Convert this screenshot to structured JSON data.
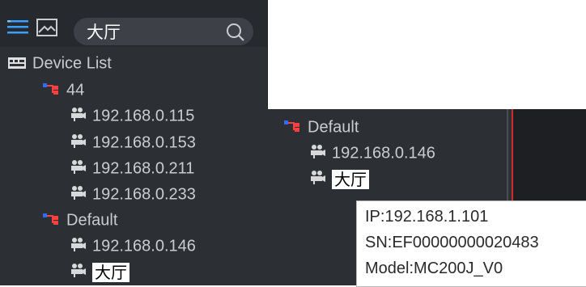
{
  "search": {
    "value": "大厅"
  },
  "tree": {
    "root_label": "Device List",
    "groups": [
      {
        "label": "44",
        "devices": [
          "192.168.0.115",
          "192.168.0.153",
          "192.168.0.211",
          "192.168.0.233"
        ]
      },
      {
        "label": "Default",
        "devices": [
          "192.168.0.146",
          "大厅"
        ]
      }
    ]
  },
  "detail_tree": {
    "group_label": "Default",
    "devices": [
      "192.168.0.146",
      "大厅"
    ]
  },
  "tooltip": {
    "ip": "IP:192.168.1.101",
    "sn": "SN:EF00000000020483",
    "model": "Model:MC200J_V0"
  },
  "icons": {
    "list_view": "list-icon",
    "image_view": "image-icon",
    "search": "search-icon",
    "device_list": "device-list-icon",
    "group": "group-icon",
    "camera": "camera-icon"
  },
  "colors": {
    "panel_bg": "#2c2f33",
    "accent_blue": "#3aa0ff",
    "selection_bg": "#ffffff",
    "red_marker": "#d22b2b"
  }
}
